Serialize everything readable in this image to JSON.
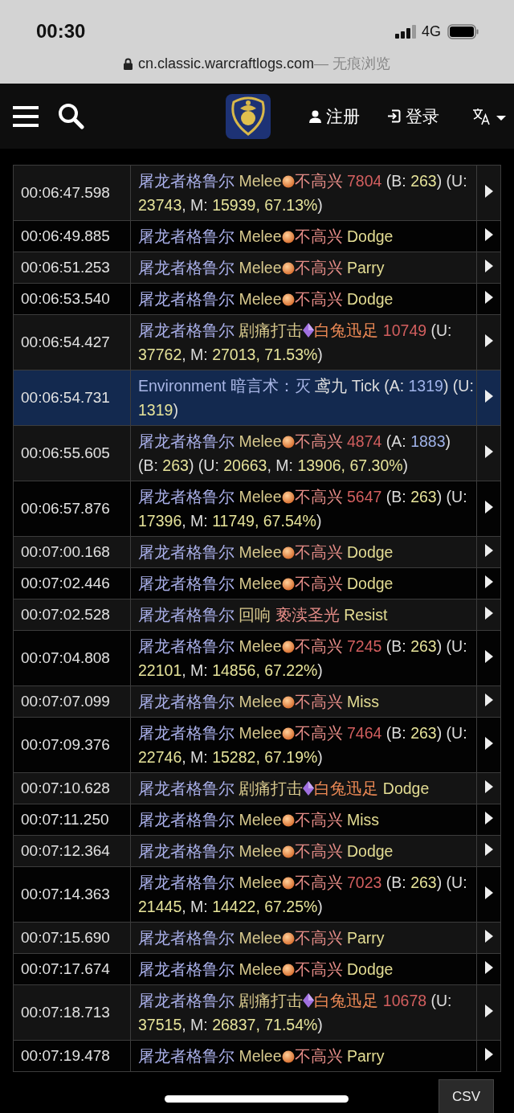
{
  "status_bar": {
    "time": "00:30",
    "network": "4G"
  },
  "browser": {
    "url": "cn.classic.warcraftlogs.com",
    "mode": " — 无痕浏览"
  },
  "nav": {
    "register": "注册",
    "login": "登录"
  },
  "rows": [
    {
      "time": "00:06:47.598",
      "selected": false,
      "kind": "orb",
      "source": [
        {
          "t": "屠龙者格鲁尔 ",
          "kind": "name"
        },
        {
          "t": "Melee",
          "kind": "ability"
        }
      ],
      "result": [
        {
          "t": "不高兴 ",
          "kind": "target"
        },
        {
          "t": "7804",
          "kind": "hit"
        },
        {
          "t": " (B: ",
          "kind": "text"
        },
        {
          "t": "263",
          "kind": "num"
        },
        {
          "t": ") (U: ",
          "kind": "text"
        },
        {
          "t": "23743",
          "kind": "num"
        },
        {
          "t": ", M: ",
          "kind": "text"
        },
        {
          "t": "15939, 67.13%",
          "kind": "num"
        },
        {
          "t": ")",
          "kind": "text"
        }
      ]
    },
    {
      "time": "00:06:49.885",
      "selected": false,
      "kind": "orb",
      "source": [
        {
          "t": "屠龙者格鲁尔 ",
          "kind": "name"
        },
        {
          "t": "Melee",
          "kind": "ability"
        }
      ],
      "result": [
        {
          "t": "不高兴 ",
          "kind": "target"
        },
        {
          "t": "Dodge",
          "kind": "miss"
        }
      ]
    },
    {
      "time": "00:06:51.253",
      "selected": false,
      "kind": "orb",
      "source": [
        {
          "t": "屠龙者格鲁尔 ",
          "kind": "name"
        },
        {
          "t": "Melee",
          "kind": "ability"
        }
      ],
      "result": [
        {
          "t": "不高兴 ",
          "kind": "target"
        },
        {
          "t": "Parry",
          "kind": "miss"
        }
      ]
    },
    {
      "time": "00:06:53.540",
      "selected": false,
      "kind": "orb",
      "source": [
        {
          "t": "屠龙者格鲁尔 ",
          "kind": "name"
        },
        {
          "t": "Melee",
          "kind": "ability"
        }
      ],
      "result": [
        {
          "t": "不高兴 ",
          "kind": "target"
        },
        {
          "t": "Dodge",
          "kind": "miss"
        }
      ]
    },
    {
      "time": "00:06:54.427",
      "selected": false,
      "kind": "gem",
      "source": [
        {
          "t": "屠龙者格鲁尔 ",
          "kind": "name"
        },
        {
          "t": "剧痛打击",
          "kind": "ability"
        }
      ],
      "result": [
        {
          "t": "白兔迅足 ",
          "kind": "pet"
        },
        {
          "t": "10749",
          "kind": "hit"
        },
        {
          "t": " (U: ",
          "kind": "text"
        },
        {
          "t": "37762",
          "kind": "num"
        },
        {
          "t": ", M: ",
          "kind": "text"
        },
        {
          "t": "27013, 71.53%",
          "kind": "num"
        },
        {
          "t": ")",
          "kind": "text"
        }
      ]
    },
    {
      "time": "00:06:54.731",
      "selected": true,
      "kind": "plain",
      "source": [
        {
          "t": "Environment ",
          "kind": "env"
        },
        {
          "t": "暗言术：灭 ",
          "kind": "env"
        },
        {
          "t": "鸢九 Tick (A: ",
          "kind": "text"
        },
        {
          "t": "1319",
          "kind": "absorb"
        },
        {
          "t": ") (U: ",
          "kind": "text"
        },
        {
          "t": "1319",
          "kind": "num"
        },
        {
          "t": ")",
          "kind": "text"
        }
      ]
    },
    {
      "time": "00:06:55.605",
      "selected": false,
      "kind": "orb",
      "source": [
        {
          "t": "屠龙者格鲁尔 ",
          "kind": "name"
        },
        {
          "t": "Melee",
          "kind": "ability"
        }
      ],
      "result": [
        {
          "t": "不高兴 ",
          "kind": "target"
        },
        {
          "t": "4874",
          "kind": "hit"
        },
        {
          "t": " (A: ",
          "kind": "text"
        },
        {
          "t": "1883",
          "kind": "absorb"
        },
        {
          "t": ") (B: ",
          "kind": "text"
        },
        {
          "t": "263",
          "kind": "num"
        },
        {
          "t": ") (U: ",
          "kind": "text"
        },
        {
          "t": "20663",
          "kind": "num"
        },
        {
          "t": ", M: ",
          "kind": "text"
        },
        {
          "t": "13906, 67.30%",
          "kind": "num"
        },
        {
          "t": ")",
          "kind": "text"
        }
      ]
    },
    {
      "time": "00:06:57.876",
      "selected": false,
      "kind": "orb",
      "source": [
        {
          "t": "屠龙者格鲁尔 ",
          "kind": "name"
        },
        {
          "t": "Melee",
          "kind": "ability"
        }
      ],
      "result": [
        {
          "t": "不高兴 ",
          "kind": "target"
        },
        {
          "t": "5647",
          "kind": "hit"
        },
        {
          "t": " (B: ",
          "kind": "text"
        },
        {
          "t": "263",
          "kind": "num"
        },
        {
          "t": ") (U: ",
          "kind": "text"
        },
        {
          "t": "17396",
          "kind": "num"
        },
        {
          "t": ", M: ",
          "kind": "text"
        },
        {
          "t": "11749, 67.54%",
          "kind": "num"
        },
        {
          "t": ")",
          "kind": "text"
        }
      ]
    },
    {
      "time": "00:07:00.168",
      "selected": false,
      "kind": "orb",
      "source": [
        {
          "t": "屠龙者格鲁尔 ",
          "kind": "name"
        },
        {
          "t": "Melee",
          "kind": "ability"
        }
      ],
      "result": [
        {
          "t": "不高兴 ",
          "kind": "target"
        },
        {
          "t": "Dodge",
          "kind": "miss"
        }
      ]
    },
    {
      "time": "00:07:02.446",
      "selected": false,
      "kind": "orb",
      "source": [
        {
          "t": "屠龙者格鲁尔 ",
          "kind": "name"
        },
        {
          "t": "Melee",
          "kind": "ability"
        }
      ],
      "result": [
        {
          "t": "不高兴 ",
          "kind": "target"
        },
        {
          "t": "Dodge",
          "kind": "miss"
        }
      ]
    },
    {
      "time": "00:07:02.528",
      "selected": false,
      "kind": "plain",
      "source": [
        {
          "t": "屠龙者格鲁尔 ",
          "kind": "name"
        },
        {
          "t": "回响 ",
          "kind": "ability"
        },
        {
          "t": "亵渎圣光 ",
          "kind": "target"
        },
        {
          "t": "Resist",
          "kind": "miss"
        }
      ]
    },
    {
      "time": "00:07:04.808",
      "selected": false,
      "kind": "orb",
      "source": [
        {
          "t": "屠龙者格鲁尔 ",
          "kind": "name"
        },
        {
          "t": "Melee",
          "kind": "ability"
        }
      ],
      "result": [
        {
          "t": "不高兴 ",
          "kind": "target"
        },
        {
          "t": "7245",
          "kind": "hit"
        },
        {
          "t": " (B: ",
          "kind": "text"
        },
        {
          "t": "263",
          "kind": "num"
        },
        {
          "t": ") (U: ",
          "kind": "text"
        },
        {
          "t": "22101",
          "kind": "num"
        },
        {
          "t": ", M: ",
          "kind": "text"
        },
        {
          "t": "14856, 67.22%",
          "kind": "num"
        },
        {
          "t": ")",
          "kind": "text"
        }
      ]
    },
    {
      "time": "00:07:07.099",
      "selected": false,
      "kind": "orb",
      "source": [
        {
          "t": "屠龙者格鲁尔 ",
          "kind": "name"
        },
        {
          "t": "Melee",
          "kind": "ability"
        }
      ],
      "result": [
        {
          "t": "不高兴 ",
          "kind": "target"
        },
        {
          "t": "Miss",
          "kind": "miss"
        }
      ]
    },
    {
      "time": "00:07:09.376",
      "selected": false,
      "kind": "orb",
      "source": [
        {
          "t": "屠龙者格鲁尔 ",
          "kind": "name"
        },
        {
          "t": "Melee",
          "kind": "ability"
        }
      ],
      "result": [
        {
          "t": "不高兴 ",
          "kind": "target"
        },
        {
          "t": "7464",
          "kind": "hit"
        },
        {
          "t": " (B: ",
          "kind": "text"
        },
        {
          "t": "263",
          "kind": "num"
        },
        {
          "t": ") (U: ",
          "kind": "text"
        },
        {
          "t": "22746",
          "kind": "num"
        },
        {
          "t": ", M: ",
          "kind": "text"
        },
        {
          "t": "15282, 67.19%",
          "kind": "num"
        },
        {
          "t": ")",
          "kind": "text"
        }
      ]
    },
    {
      "time": "00:07:10.628",
      "selected": false,
      "kind": "gem",
      "source": [
        {
          "t": "屠龙者格鲁尔 ",
          "kind": "name"
        },
        {
          "t": "剧痛打击",
          "kind": "ability"
        }
      ],
      "result": [
        {
          "t": "白兔迅足 ",
          "kind": "pet"
        },
        {
          "t": "Dodge",
          "kind": "miss"
        }
      ]
    },
    {
      "time": "00:07:11.250",
      "selected": false,
      "kind": "orb",
      "source": [
        {
          "t": "屠龙者格鲁尔 ",
          "kind": "name"
        },
        {
          "t": "Melee",
          "kind": "ability"
        }
      ],
      "result": [
        {
          "t": "不高兴 ",
          "kind": "target"
        },
        {
          "t": "Miss",
          "kind": "miss"
        }
      ]
    },
    {
      "time": "00:07:12.364",
      "selected": false,
      "kind": "orb",
      "source": [
        {
          "t": "屠龙者格鲁尔 ",
          "kind": "name"
        },
        {
          "t": "Melee",
          "kind": "ability"
        }
      ],
      "result": [
        {
          "t": "不高兴 ",
          "kind": "target"
        },
        {
          "t": "Dodge",
          "kind": "miss"
        }
      ]
    },
    {
      "time": "00:07:14.363",
      "selected": false,
      "kind": "orb",
      "source": [
        {
          "t": "屠龙者格鲁尔 ",
          "kind": "name"
        },
        {
          "t": "Melee",
          "kind": "ability"
        }
      ],
      "result": [
        {
          "t": "不高兴 ",
          "kind": "target"
        },
        {
          "t": "7023",
          "kind": "hit"
        },
        {
          "t": " (B: ",
          "kind": "text"
        },
        {
          "t": "263",
          "kind": "num"
        },
        {
          "t": ") (U: ",
          "kind": "text"
        },
        {
          "t": "21445",
          "kind": "num"
        },
        {
          "t": ", M: ",
          "kind": "text"
        },
        {
          "t": "14422, 67.25%",
          "kind": "num"
        },
        {
          "t": ")",
          "kind": "text"
        }
      ]
    },
    {
      "time": "00:07:15.690",
      "selected": false,
      "kind": "orb",
      "source": [
        {
          "t": "屠龙者格鲁尔 ",
          "kind": "name"
        },
        {
          "t": "Melee",
          "kind": "ability"
        }
      ],
      "result": [
        {
          "t": "不高兴 ",
          "kind": "target"
        },
        {
          "t": "Parry",
          "kind": "miss"
        }
      ]
    },
    {
      "time": "00:07:17.674",
      "selected": false,
      "kind": "orb",
      "source": [
        {
          "t": "屠龙者格鲁尔 ",
          "kind": "name"
        },
        {
          "t": "Melee",
          "kind": "ability"
        }
      ],
      "result": [
        {
          "t": "不高兴 ",
          "kind": "target"
        },
        {
          "t": "Dodge",
          "kind": "miss"
        }
      ]
    },
    {
      "time": "00:07:18.713",
      "selected": false,
      "kind": "gem",
      "source": [
        {
          "t": "屠龙者格鲁尔 ",
          "kind": "name"
        },
        {
          "t": "剧痛打击",
          "kind": "ability"
        }
      ],
      "result": [
        {
          "t": "白兔迅足 ",
          "kind": "pet"
        },
        {
          "t": "10678",
          "kind": "hit"
        },
        {
          "t": " (U: ",
          "kind": "text"
        },
        {
          "t": "37515",
          "kind": "num"
        },
        {
          "t": ", M: ",
          "kind": "text"
        },
        {
          "t": "26837, 71.54%",
          "kind": "num"
        },
        {
          "t": ")",
          "kind": "text"
        }
      ]
    },
    {
      "time": "00:07:19.478",
      "selected": false,
      "kind": "orb",
      "source": [
        {
          "t": "屠龙者格鲁尔 ",
          "kind": "name"
        },
        {
          "t": "Melee",
          "kind": "ability"
        }
      ],
      "result": [
        {
          "t": "不高兴 ",
          "kind": "target"
        },
        {
          "t": "Parry",
          "kind": "miss"
        }
      ]
    }
  ],
  "export_button": "CSV"
}
